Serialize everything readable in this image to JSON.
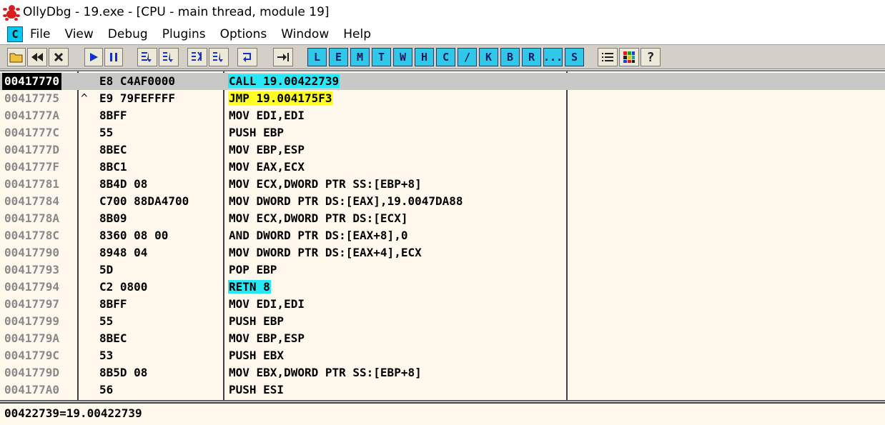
{
  "window": {
    "title": "OllyDbg - 19.exe - [CPU - main thread, module 19]"
  },
  "menu": {
    "system_button": "C",
    "items": [
      "File",
      "View",
      "Debug",
      "Plugins",
      "Options",
      "Window",
      "Help"
    ]
  },
  "toolbar": {
    "letters": [
      "L",
      "E",
      "M",
      "T",
      "W",
      "H",
      "C",
      "/",
      "K",
      "B",
      "R",
      "...",
      "S"
    ]
  },
  "disasm": {
    "rows": [
      {
        "addr": "00417770",
        "mark": "",
        "hex": "E8 C4AF0000",
        "asm": "CALL 19.00422739",
        "hl": "cyan"
      },
      {
        "addr": "00417775",
        "mark": "^",
        "hex": "E9 79FEFFFF",
        "asm": "JMP 19.004175F3",
        "hl": "yellow"
      },
      {
        "addr": "0041777A",
        "mark": "",
        "hex": "8BFF",
        "asm": "MOV EDI,EDI",
        "hl": ""
      },
      {
        "addr": "0041777C",
        "mark": "",
        "hex": "55",
        "asm": "PUSH EBP",
        "hl": ""
      },
      {
        "addr": "0041777D",
        "mark": "",
        "hex": "8BEC",
        "asm": "MOV EBP,ESP",
        "hl": ""
      },
      {
        "addr": "0041777F",
        "mark": "",
        "hex": "8BC1",
        "asm": "MOV EAX,ECX",
        "hl": ""
      },
      {
        "addr": "00417781",
        "mark": "",
        "hex": "8B4D 08",
        "asm": "MOV ECX,DWORD PTR SS:[EBP+8]",
        "hl": ""
      },
      {
        "addr": "00417784",
        "mark": "",
        "hex": "C700 88DA4700",
        "asm": "MOV DWORD PTR DS:[EAX],19.0047DA88",
        "hl": ""
      },
      {
        "addr": "0041778A",
        "mark": "",
        "hex": "8B09",
        "asm": "MOV ECX,DWORD PTR DS:[ECX]",
        "hl": ""
      },
      {
        "addr": "0041778C",
        "mark": "",
        "hex": "8360 08 00",
        "asm": "AND DWORD PTR DS:[EAX+8],0",
        "hl": ""
      },
      {
        "addr": "00417790",
        "mark": "",
        "hex": "8948 04",
        "asm": "MOV DWORD PTR DS:[EAX+4],ECX",
        "hl": ""
      },
      {
        "addr": "00417793",
        "mark": "",
        "hex": "5D",
        "asm": "POP EBP",
        "hl": ""
      },
      {
        "addr": "00417794",
        "mark": "",
        "hex": "C2 0800",
        "asm": "RETN 8",
        "hl": "cyan"
      },
      {
        "addr": "00417797",
        "mark": "",
        "hex": "8BFF",
        "asm": "MOV EDI,EDI",
        "hl": ""
      },
      {
        "addr": "00417799",
        "mark": "",
        "hex": "55",
        "asm": "PUSH EBP",
        "hl": ""
      },
      {
        "addr": "0041779A",
        "mark": "",
        "hex": "8BEC",
        "asm": "MOV EBP,ESP",
        "hl": ""
      },
      {
        "addr": "0041779C",
        "mark": "",
        "hex": "53",
        "asm": "PUSH EBX",
        "hl": ""
      },
      {
        "addr": "0041779D",
        "mark": "",
        "hex": "8B5D 08",
        "asm": "MOV EBX,DWORD PTR SS:[EBP+8]",
        "hl": ""
      },
      {
        "addr": "004177A0",
        "mark": "",
        "hex": "56",
        "asm": "PUSH ESI",
        "hl": ""
      }
    ]
  },
  "info": {
    "text": "00422739=19.00422739"
  },
  "colors": {
    "highlight_cyan": "#28e8f8",
    "highlight_yellow": "#ffff20",
    "pane_bg": "#fff8ec"
  }
}
